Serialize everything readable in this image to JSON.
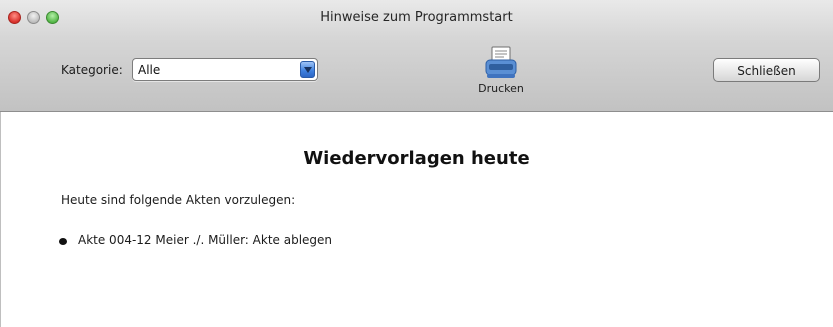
{
  "window": {
    "title": "Hinweise zum Programmstart"
  },
  "toolbar": {
    "category_label": "Kategorie:",
    "category_value": "Alle",
    "print_label": "Drucken",
    "close_label": "Schließen"
  },
  "content": {
    "heading": "Wiedervorlagen heute",
    "intro": "Heute sind folgende Akten vorzulegen:",
    "items": [
      {
        "text": "Akte 004-12 Meier ./. Müller: Akte ablegen"
      }
    ]
  },
  "icons": {
    "close": "close-icon",
    "minimize": "minimize-icon",
    "zoom": "zoom-icon",
    "dropdown": "chevron-down-icon",
    "print": "printer-icon"
  },
  "colors": {
    "close": "#e0443e",
    "minimize": "#c9c9c9",
    "zoom": "#5fc452",
    "dropdown_accent": "#3d7fde"
  }
}
